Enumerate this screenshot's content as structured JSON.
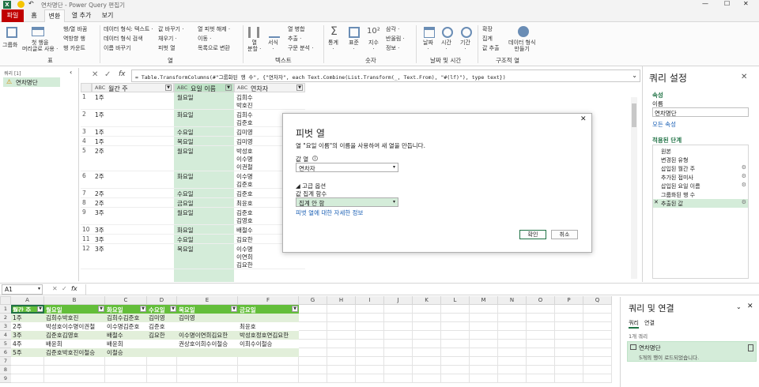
{
  "titlebar": {
    "title": "연차명단 - Power Query 편집기",
    "undo": "↶",
    "win_min": "—",
    "win_max": "☐",
    "win_close": "✕"
  },
  "tabs": [
    {
      "label": "파일"
    },
    {
      "label": "홈"
    },
    {
      "label": "변환"
    },
    {
      "label": "열 추가"
    },
    {
      "label": "보기"
    }
  ],
  "ribbon": {
    "group1_buttons": [
      "그룹화",
      "첫 행을\n머리글로 사용 ·"
    ],
    "small1": [
      "행/열 바꿈",
      "역방향 행",
      "행 카운트"
    ],
    "small2": [
      "데이터 형식: 텍스트 ·",
      "데이터 형식 검색",
      "이름 바꾸기"
    ],
    "small3": [
      "값 바꾸기 ·",
      "채우기 ·",
      "피벗 열"
    ],
    "small4": [
      "열 피벗 해제 ·",
      "이동 ·",
      "목록으로 변환"
    ],
    "col_buttons": [
      "열\n분할 ·",
      "서식\n·"
    ],
    "small5": [
      "열 병합",
      "추출 ·",
      "구문 분석 ·"
    ],
    "num_buttons": [
      "통계\n·",
      "표준\n·",
      "지수\n·"
    ],
    "small6": [
      "삼각 ·",
      "반올림 ·",
      "정보 ·"
    ],
    "dt_buttons": [
      "날짜\n·",
      "시간\n·",
      "기간\n·"
    ],
    "small7": [
      "확장",
      "집계",
      "값 추출"
    ],
    "struct_button": "데이터 형식\n만들기",
    "group_labels": [
      "표",
      "열",
      "텍스트",
      "숫자",
      "날짜 및 시간",
      "구조적 열"
    ]
  },
  "queries": {
    "header": "쿼리 [1]",
    "items": [
      "연차명단"
    ]
  },
  "formula": {
    "text": "= Table.TransformColumns(#\"그룹화된 행 수\", {\"연차자\", each Text.Combine(List.Transform(_, Text.From), \"#(lf)\"), type text})"
  },
  "preview": {
    "columns": [
      "월간 주",
      "요일 이름",
      "연차자"
    ],
    "rows": [
      {
        "n": "1",
        "week": "1주",
        "day": "월요일",
        "names": [
          "김희수",
          "박호진"
        ]
      },
      {
        "n": "2",
        "week": "1주",
        "day": "화요일",
        "names": [
          "김희수",
          "김준호"
        ]
      },
      {
        "n": "3",
        "week": "1주",
        "day": "수요일",
        "names": [
          "김미영"
        ]
      },
      {
        "n": "4",
        "week": "1주",
        "day": "목요일",
        "names": [
          "김미영"
        ]
      },
      {
        "n": "5",
        "week": "2주",
        "day": "월요일",
        "names": [
          "박성호",
          "이수명",
          "이권철"
        ]
      },
      {
        "n": "6",
        "week": "2주",
        "day": "화요일",
        "names": [
          "이수명",
          "김준호"
        ]
      },
      {
        "n": "7",
        "week": "2주",
        "day": "수요일",
        "names": [
          "김준호"
        ]
      },
      {
        "n": "8",
        "week": "2주",
        "day": "금요일",
        "names": [
          "최윤호"
        ]
      },
      {
        "n": "9",
        "week": "3주",
        "day": "월요일",
        "names": [
          "김준호",
          "김영호"
        ]
      },
      {
        "n": "10",
        "week": "3주",
        "day": "화요일",
        "names": [
          "배철수"
        ]
      },
      {
        "n": "11",
        "week": "3주",
        "day": "수요일",
        "names": [
          "김요한"
        ]
      },
      {
        "n": "12",
        "week": "3주",
        "day": "목요일",
        "names": [
          "이수명",
          "이연희",
          "김요한"
        ]
      }
    ]
  },
  "settings": {
    "title": "쿼리 설정",
    "props_header": "속성",
    "name_label": "이름",
    "name_value": "연차명단",
    "all_props": "모든 속성",
    "steps_header": "적용된 단계",
    "steps": [
      "원본",
      "변경된 유형",
      "삽입된 월간 주",
      "추가된 접미사",
      "삽입된 요일 이름",
      "그룹화된 행 수",
      "추출된 값"
    ],
    "gear": "⚙"
  },
  "dialog": {
    "title": "피벗 열",
    "desc": "열 \"요일 이름\"의 이름을 사용하여 새 열을 만듭니다.",
    "value_col_label": "값 열",
    "value_col": "연차자",
    "advanced": "◢ 고급 옵션",
    "agg_label": "값 집계 함수",
    "agg_value": "집계 안 함",
    "link": "피벗 열에 대한 자세한 정보",
    "ok": "확인",
    "cancel": "취소",
    "close": "✕"
  },
  "excel": {
    "namebox": "A1",
    "fx": "fx",
    "col_letters": [
      "A",
      "B",
      "C",
      "D",
      "E",
      "F",
      "G",
      "H",
      "I",
      "J",
      "K",
      "L",
      "M",
      "N",
      "O",
      "P",
      "Q"
    ],
    "headers": [
      "월간 주",
      "월요일",
      "화요일",
      "수요일",
      "목요일",
      "금요일"
    ],
    "rows": [
      [
        "1주",
        "김희수박호진",
        "김희수김준호",
        "김미영",
        "김미영",
        ""
      ],
      [
        "2주",
        "박성호이수명이권철",
        "이수명김준호",
        "김준호",
        "",
        "최윤호"
      ],
      [
        "3주",
        "김준호김영호",
        "배철수",
        "김요한",
        "이수명이연희김요한",
        "박성호정호연김요한"
      ],
      [
        "4주",
        "배윤희",
        "배윤희",
        "",
        "권상호이희수이철승",
        "이희수이철승"
      ],
      [
        "5주",
        "김준호박호진이철승",
        "이철승",
        "",
        "",
        ""
      ]
    ]
  },
  "conn": {
    "title": "쿼리 및 연결",
    "tabs": [
      "쿼리",
      "연결"
    ],
    "count": "1개 쿼리",
    "query_name": "연차명단",
    "query_status": "5개의 행이 로드되었습니다."
  },
  "colors": {
    "excel_green": "#217346",
    "header_green": "#63be3a",
    "pane_green": "#d4ecd9",
    "accent_red": "#c00000"
  }
}
